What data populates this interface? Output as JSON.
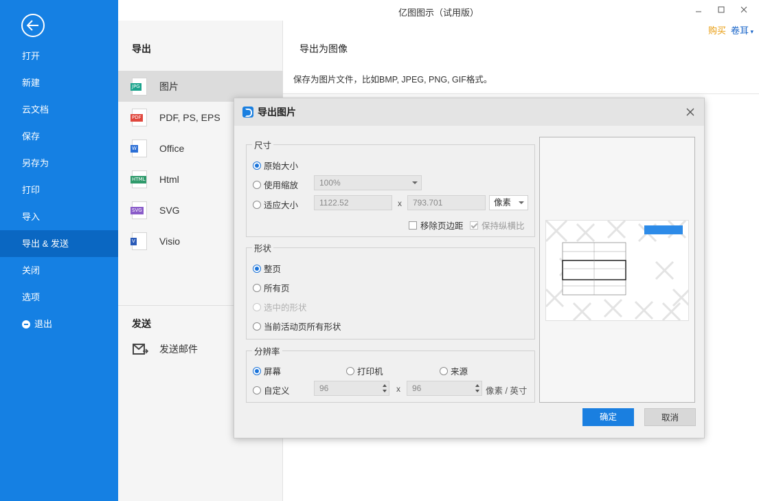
{
  "window": {
    "title": "亿图图示（试用版）",
    "buy_label": "购买",
    "user_label": "卷耳"
  },
  "sidebar": {
    "items": [
      {
        "label": "打开"
      },
      {
        "label": "新建"
      },
      {
        "label": "云文档"
      },
      {
        "label": "保存"
      },
      {
        "label": "另存为"
      },
      {
        "label": "打印"
      },
      {
        "label": "导入"
      },
      {
        "label": "导出 & 发送"
      },
      {
        "label": "关闭"
      },
      {
        "label": "选项"
      },
      {
        "label": "退出"
      }
    ]
  },
  "middle": {
    "export_heading": "导出",
    "formats": [
      {
        "label": "图片",
        "badge": "JPG",
        "badge_color": "#1aa38c"
      },
      {
        "label": "PDF, PS, EPS",
        "badge": "PDF",
        "badge_color": "#e0473d"
      },
      {
        "label": "Office",
        "badge": "W",
        "badge_color": "#2b6fd6"
      },
      {
        "label": "Html",
        "badge": "HTML",
        "badge_color": "#2f9a6b"
      },
      {
        "label": "SVG",
        "badge": "SVG",
        "badge_color": "#8a5cc9"
      },
      {
        "label": "Visio",
        "badge": "V",
        "badge_color": "#2a5bb8"
      }
    ],
    "send_heading": "发送",
    "send_mail_label": "发送邮件"
  },
  "content": {
    "title": "导出为图像",
    "description": "保存为图片文件，比如BMP, JPEG, PNG, GIF格式。"
  },
  "dialog": {
    "title": "导出图片",
    "size": {
      "legend": "尺寸",
      "original_label": "原始大小",
      "scale_label": "使用缩放",
      "scale_value": "100%",
      "fit_label": "适应大小",
      "width_value": "1122.52",
      "times": "x",
      "height_value": "793.701",
      "unit_value": "像素",
      "remove_margin_label": "移除页边距",
      "keep_ratio_label": "保持纵横比"
    },
    "shape": {
      "legend": "形状",
      "whole_page_label": "整页",
      "all_pages_label": "所有页",
      "selected_label": "选中的形状",
      "current_page_label": "当前活动页所有形状"
    },
    "resolution": {
      "legend": "分辨率",
      "screen_label": "屏幕",
      "printer_label": "打印机",
      "source_label": "来源",
      "custom_label": "自定义",
      "dpi_x": "96",
      "times": "x",
      "dpi_y": "96",
      "unit_label": "像素 / 英寸"
    },
    "ok_label": "确定",
    "cancel_label": "取消"
  }
}
